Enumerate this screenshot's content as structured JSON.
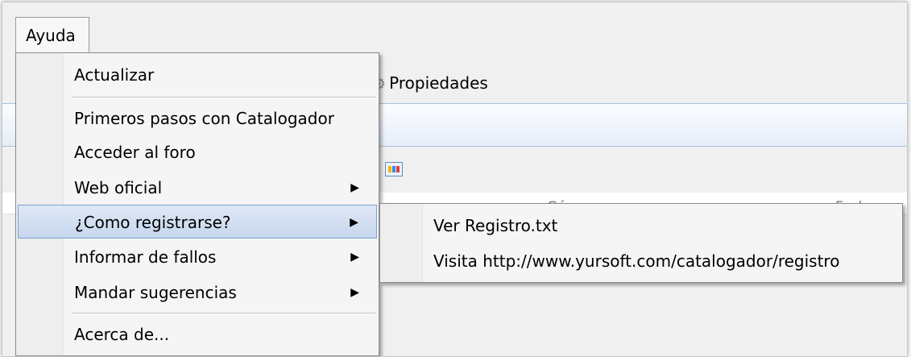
{
  "menubar": {
    "help_label": "Ayuda"
  },
  "background": {
    "properties_label": "Propiedades",
    "columns": [
      "Género",
      "Fecha pu"
    ]
  },
  "help_menu": {
    "items": [
      {
        "label": "Actualizar",
        "submenu": false
      },
      {
        "label": "Primeros pasos con Catalogador",
        "submenu": false
      },
      {
        "label": "Acceder al foro",
        "submenu": false
      },
      {
        "label": "Web oficial",
        "submenu": true
      },
      {
        "label": "¿Como registrarse?",
        "submenu": true,
        "highlighted": true
      },
      {
        "label": "Informar de fallos",
        "submenu": true
      },
      {
        "label": "Mandar sugerencias",
        "submenu": true
      },
      {
        "label": "Acerca de...",
        "submenu": false
      }
    ]
  },
  "register_submenu": {
    "items": [
      {
        "label": "Ver Registro.txt"
      },
      {
        "label": "Visita http://www.yursoft.com/catalogador/registro"
      }
    ]
  },
  "icons": {
    "submenu_arrow": "triangle-right-icon",
    "properties": "gear-icon",
    "view": "grid-view-icon"
  },
  "colors": {
    "highlight": "#c7d7ee",
    "highlight_border": "#7da2ce",
    "menu_bg": "#f5f5f5"
  }
}
